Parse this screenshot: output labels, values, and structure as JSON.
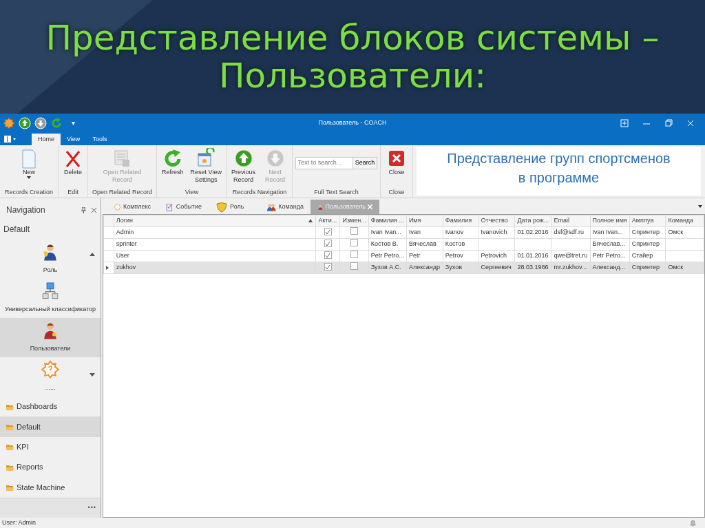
{
  "slide": {
    "title": "Представление блоков системы –\nПользователи:"
  },
  "window": {
    "title": "Пользователь - COACH",
    "quick_access": "▾"
  },
  "ribbon_tabs": [
    {
      "label": "Home",
      "selected": true
    },
    {
      "label": "View",
      "selected": false
    },
    {
      "label": "Tools",
      "selected": false
    }
  ],
  "ribbon_groups": [
    {
      "label": "Records Creation",
      "buttons": [
        {
          "label": "New",
          "disabled": false,
          "dropdown": true
        }
      ]
    },
    {
      "label": "Edit",
      "buttons": [
        {
          "label": "Delete",
          "disabled": false
        }
      ]
    },
    {
      "label": "Open Related Record",
      "buttons": [
        {
          "label": "Open Related\nRecord",
          "disabled": true
        }
      ]
    },
    {
      "label": "View",
      "buttons": [
        {
          "label": "Refresh",
          "disabled": false
        },
        {
          "label": "Reset View\nSettings",
          "disabled": false
        }
      ]
    },
    {
      "label": "Records Navigation",
      "buttons": [
        {
          "label": "Previous\nRecord",
          "disabled": false
        },
        {
          "label": "Next Record",
          "disabled": true
        }
      ]
    },
    {
      "label": "Full Text Search",
      "search": {
        "placeholder": "Text to search...",
        "button": "Search"
      }
    },
    {
      "label": "Close",
      "buttons": [
        {
          "label": "Close",
          "disabled": false
        }
      ]
    }
  ],
  "ribbon_note": "Представление групп спортсменов\nв программе",
  "navigation": {
    "title": "Navigation",
    "group": "Default",
    "large_items": [
      {
        "label": "Роль",
        "selected": false
      },
      {
        "label": "Универсальный классификатор",
        "selected": false
      },
      {
        "label": "Пользователи",
        "selected": true
      },
      {
        "label": "......",
        "selected": false
      }
    ],
    "folders": [
      {
        "label": "Dashboards",
        "selected": false
      },
      {
        "label": "Default",
        "selected": true
      },
      {
        "label": "KPI",
        "selected": false
      },
      {
        "label": "Reports",
        "selected": false
      },
      {
        "label": "State Machine",
        "selected": false
      }
    ],
    "more": "•••"
  },
  "doc_tabs": [
    {
      "label": "Комплекс",
      "selected": false
    },
    {
      "label": "Событие",
      "selected": false
    },
    {
      "label": "Роль",
      "selected": false
    },
    {
      "label": "Команда",
      "selected": false
    },
    {
      "label": "Пользователь",
      "selected": true
    }
  ],
  "table": {
    "columns": [
      {
        "label": "Логин",
        "kind": "text",
        "sorted": true
      },
      {
        "label": "Акти...",
        "kind": "check",
        "sorted": false
      },
      {
        "label": "Измен...",
        "kind": "check",
        "sorted": false
      },
      {
        "label": "Фамилия ...",
        "kind": "text",
        "sorted": false
      },
      {
        "label": "Имя",
        "kind": "text",
        "sorted": false
      },
      {
        "label": "Фамилия",
        "kind": "text",
        "sorted": false
      },
      {
        "label": "Отчество",
        "kind": "text",
        "sorted": false
      },
      {
        "label": "Дата рож...",
        "kind": "text",
        "sorted": false
      },
      {
        "label": "Email",
        "kind": "text",
        "sorted": false
      },
      {
        "label": "Полное имя",
        "kind": "text",
        "sorted": false
      },
      {
        "label": "Амплуа",
        "kind": "text",
        "sorted": false
      },
      {
        "label": "Команда",
        "kind": "text",
        "sorted": false
      }
    ],
    "rows": [
      {
        "selected": false,
        "cells": [
          "Admin",
          true,
          false,
          "Ivan Ivan...",
          "Ivan",
          "Ivanov",
          "Ivanovich",
          "01.02.2016",
          "dsf@sdf.ru",
          "Ivan Ivan...",
          "Спринтер",
          "Омск"
        ]
      },
      {
        "selected": false,
        "cells": [
          "sprinter",
          true,
          false,
          "Костов В.",
          "Вячеслав",
          "Костов",
          null,
          null,
          null,
          "Вячеслав...",
          "Спринтер",
          null
        ]
      },
      {
        "selected": false,
        "cells": [
          "User",
          true,
          false,
          "Petr Petro...",
          "Petr",
          "Petrov",
          "Petrovich",
          "01.01.2016",
          "qwe@tret.ru",
          "Petr Petro...",
          "Стайер",
          null
        ]
      },
      {
        "selected": true,
        "cells": [
          "zukhov",
          true,
          false,
          "Зухов А.С.",
          "Александр",
          "Зухов",
          "Сергеевич",
          "28.03.1986",
          "mr.zukhov...",
          "Александ...",
          "Спринтер",
          "Омск"
        ]
      }
    ]
  },
  "status_bar": {
    "text": "User: Admin"
  }
}
